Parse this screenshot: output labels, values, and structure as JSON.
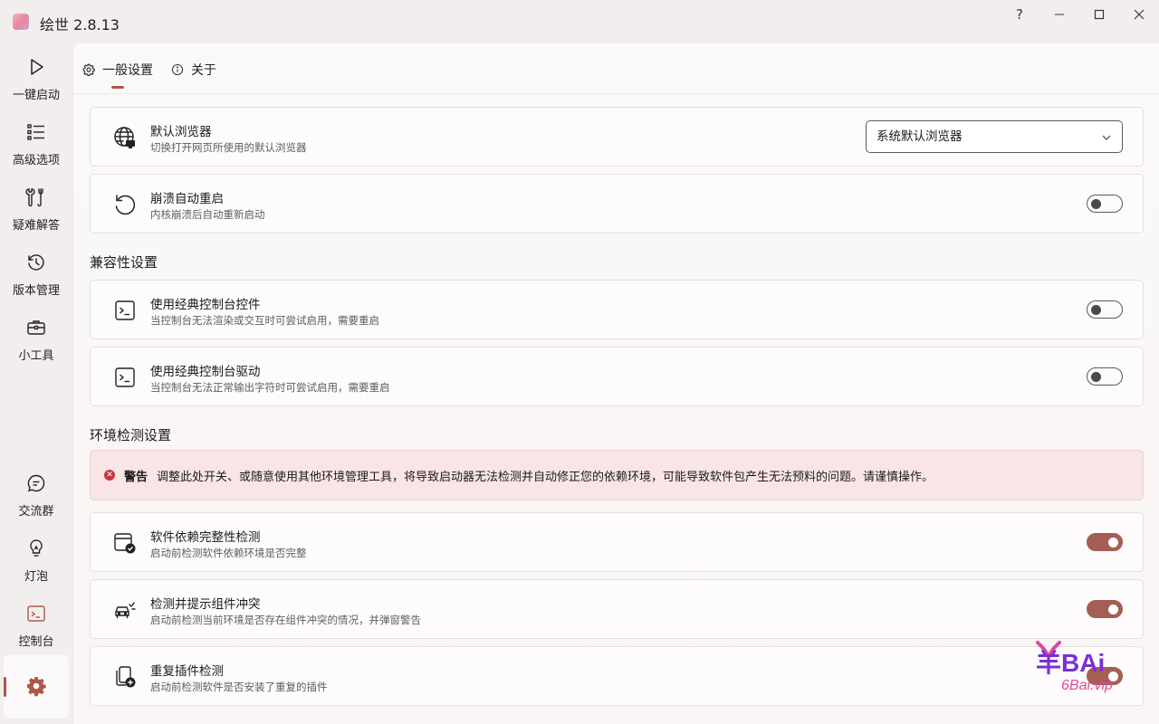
{
  "window": {
    "title": "绘世 2.8.13",
    "help_glyph": "?",
    "minimize_glyph": "—",
    "maximize_glyph": "☐",
    "close_glyph": "✕"
  },
  "sidebar": {
    "items": [
      {
        "label": "一键启动",
        "icon": "play-icon"
      },
      {
        "label": "高级选项",
        "icon": "list-icon"
      },
      {
        "label": "疑难解答",
        "icon": "wrench-icon"
      },
      {
        "label": "版本管理",
        "icon": "history-icon"
      },
      {
        "label": "小工具",
        "icon": "toolbox-icon"
      },
      {
        "label": "交流群",
        "icon": "chat-icon"
      },
      {
        "label": "灯泡",
        "icon": "bulb-icon"
      },
      {
        "label": "控制台",
        "icon": "terminal-icon"
      }
    ],
    "settings_icon": "gear-icon"
  },
  "tabs": [
    {
      "label": "一般设置",
      "icon": "gear-icon",
      "active": true
    },
    {
      "label": "关于",
      "icon": "info-icon",
      "active": false
    }
  ],
  "settings": {
    "browser": {
      "title": "默认浏览器",
      "desc": "切换打开网页所使用的默认浏览器",
      "value": "系统默认浏览器"
    },
    "crash_restart": {
      "title": "崩溃自动重启",
      "desc": "内核崩溃后自动重新启动",
      "enabled": false
    }
  },
  "compat": {
    "heading": "兼容性设置",
    "items": [
      {
        "title": "使用经典控制台控件",
        "desc": "当控制台无法渲染或交互时可尝试启用，需要重启",
        "enabled": false
      },
      {
        "title": "使用经典控制台驱动",
        "desc": "当控制台无法正常输出字符时可尝试启用，需要重启",
        "enabled": false
      }
    ]
  },
  "env": {
    "heading": "环境检测设置",
    "warning_title": "警告",
    "warning_text": "调整此处开关、或随意使用其他环境管理工具，将导致启动器无法检测并自动修正您的依赖环境，可能导致软件包产生无法预料的问题。请谨慎操作。",
    "items": [
      {
        "title": "软件依赖完整性检测",
        "desc": "启动前检测软件依赖环境是否完整",
        "enabled": true
      },
      {
        "title": "检测并提示组件冲突",
        "desc": "启动前检测当前环境是否存在组件冲突的情况，并弹窗警告",
        "enabled": true
      },
      {
        "title": "重复插件检测",
        "desc": "启动前检测软件是否安装了重复的插件",
        "enabled": true
      }
    ]
  },
  "watermark": {
    "line1": "羊BAi",
    "line2": "6Bai.vip"
  },
  "colors": {
    "accent": "#a55e54",
    "warning_bg": "#f9e5e6",
    "warning_dot": "#c9373f"
  }
}
